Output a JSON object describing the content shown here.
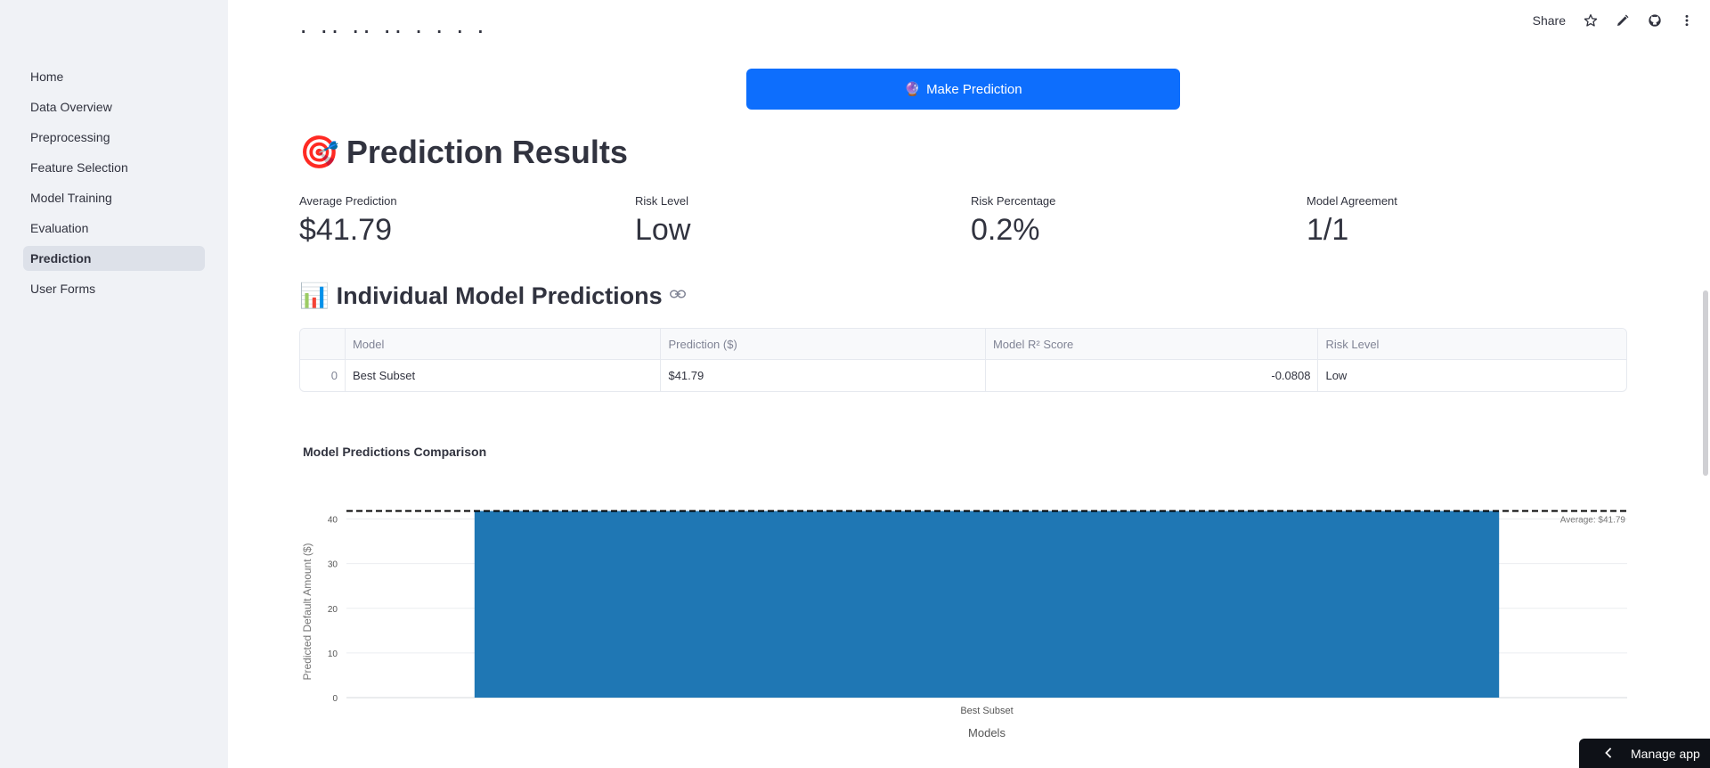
{
  "sidebar": {
    "items": [
      {
        "label": "Home"
      },
      {
        "label": "Data Overview"
      },
      {
        "label": "Preprocessing"
      },
      {
        "label": "Feature Selection"
      },
      {
        "label": "Model Training"
      },
      {
        "label": "Evaluation"
      },
      {
        "label": "Prediction"
      },
      {
        "label": "User Forms"
      }
    ],
    "active": "Prediction"
  },
  "toolbar": {
    "share_label": "Share",
    "icons": [
      "star-icon",
      "pencil-icon",
      "github-icon",
      "more-vertical-icon"
    ]
  },
  "main": {
    "cut_heading": "· ·· ·· ·· · · · · ·",
    "predict_button": {
      "icon": "🔮",
      "label": "Make Prediction"
    },
    "results_heading": {
      "icon": "🎯",
      "title": "Prediction Results"
    },
    "metrics": [
      {
        "label": "Average Prediction",
        "value": "$41.79"
      },
      {
        "label": "Risk Level",
        "value": "Low"
      },
      {
        "label": "Risk Percentage",
        "value": "0.2%"
      },
      {
        "label": "Model Agreement",
        "value": "1/1"
      }
    ],
    "individual_heading": {
      "icon": "📊",
      "title": "Individual Model Predictions"
    },
    "table": {
      "columns": [
        "",
        "Model",
        "Prediction ($)",
        "Model R² Score",
        "Risk Level"
      ],
      "rows": [
        [
          "0",
          "Best Subset",
          "$41.79",
          "-0.0808",
          "Low"
        ]
      ]
    }
  },
  "chart_data": {
    "type": "bar",
    "title": "Model Predictions Comparison",
    "categories": [
      "Best Subset"
    ],
    "values": [
      41.79
    ],
    "xlabel": "Models",
    "ylabel": "Predicted Default Amount ($)",
    "ylim": [
      0,
      42.5
    ],
    "yticks": [
      0,
      10,
      20,
      30,
      40
    ],
    "grid": true,
    "bar_color": "#1f77b4",
    "reference_line": {
      "value": 41.79,
      "label": "Average: $41.79",
      "style": "dashed"
    }
  },
  "manage_app": {
    "label": "Manage app"
  },
  "colors": {
    "accent": "#0d6efd",
    "sidebar_bg": "#f0f2f6",
    "bar": "#1f77b4"
  }
}
